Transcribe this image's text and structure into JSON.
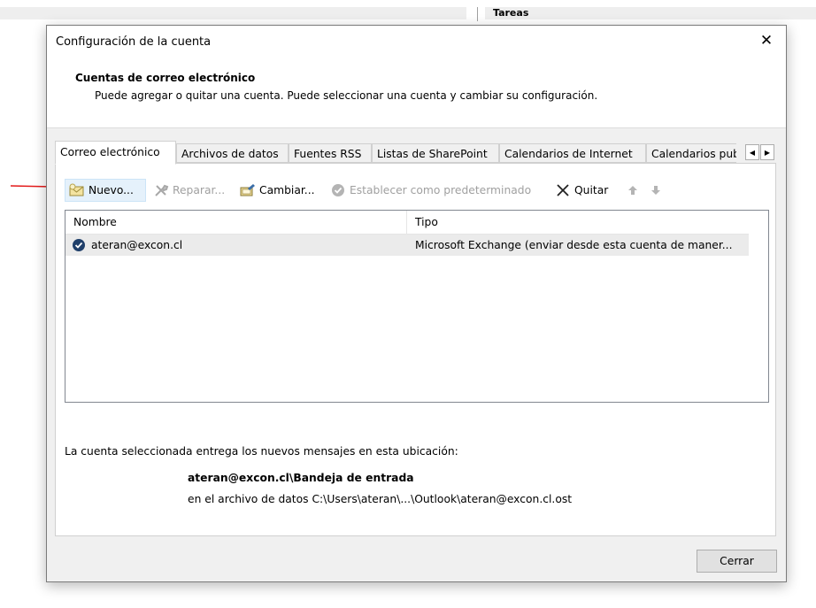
{
  "background": {
    "right_label": "Tareas"
  },
  "dialog": {
    "title": "Configuración de la cuenta",
    "close_glyph": "✕",
    "header": {
      "title": "Cuentas de correo electrónico",
      "description": "Puede agregar o quitar una cuenta. Puede seleccionar una cuenta y cambiar su configuración."
    },
    "tabs": [
      {
        "label": "Correo electrónico",
        "active": true
      },
      {
        "label": "Archivos de datos"
      },
      {
        "label": "Fuentes RSS"
      },
      {
        "label": "Listas de SharePoint"
      },
      {
        "label": "Calendarios de Internet"
      },
      {
        "label": "Calendarios publicados"
      }
    ],
    "tab_scroll": {
      "left": "◀",
      "right": "▶"
    },
    "toolbar": {
      "new_label": "Nuevo...",
      "repair_label": "Reparar...",
      "change_label": "Cambiar...",
      "default_label": "Establecer como predeterminado",
      "remove_label": "Quitar"
    },
    "accounts_table": {
      "columns": [
        "Nombre",
        "Tipo"
      ],
      "rows": [
        {
          "name": "ateran@excon.cl",
          "type": "Microsoft Exchange (enviar desde esta cuenta de maner..."
        }
      ]
    },
    "delivery": {
      "intro": "La cuenta seleccionada entrega los nuevos mensajes en esta ubicación:",
      "location": "ateran@excon.cl\\Bandeja de entrada",
      "file": "en el archivo de datos C:\\Users\\ateran\\...\\Outlook\\ateran@excon.cl.ost"
    },
    "close_button": "Cerrar"
  },
  "colors": {
    "annotation_arrow": "#e31b1b",
    "selected_row": "#ebebeb",
    "highlight_button": "#e5f1fb"
  }
}
